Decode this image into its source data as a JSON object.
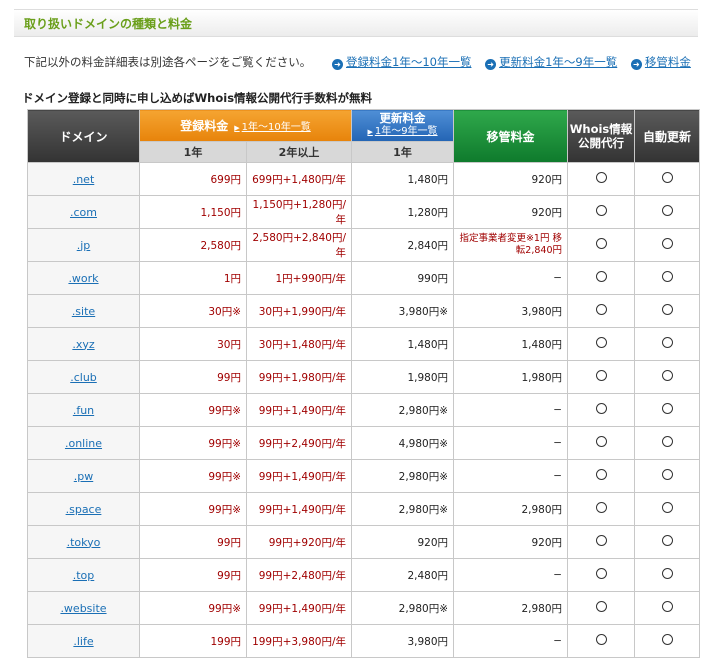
{
  "header": {
    "title": "取り扱いドメインの種類と料金"
  },
  "info": {
    "text": "下記以外の料金詳細表は別途各ページをご覧ください。",
    "links": [
      {
        "label": "登録料金1年〜10年一覧"
      },
      {
        "label": "更新料金1年〜9年一覧"
      },
      {
        "label": "移管料金"
      }
    ]
  },
  "note": "ドメイン登録と同時に申し込めばWhois情報公開代行手数料が無料",
  "table": {
    "headers": {
      "domain": "ドメイン",
      "registration": "登録料金",
      "registration_link": "1年〜10年一覧",
      "renewal": "更新料金",
      "renewal_link": "1年〜9年一覧",
      "transfer": "移管料金",
      "whois": "Whois情報公開代行",
      "auto_renew": "自動更新",
      "year1": "1年",
      "year2plus": "2年以上",
      "renew_year1": "1年"
    },
    "rows": [
      {
        "domain": ".net",
        "reg1": "699円",
        "reg2": "699円+1,480円/年",
        "renew": "1,480円",
        "transfer": "920円",
        "whois": "○",
        "auto": "○"
      },
      {
        "domain": ".com",
        "reg1": "1,150円",
        "reg2": "1,150円+1,280円/年",
        "renew": "1,280円",
        "transfer": "920円",
        "whois": "○",
        "auto": "○"
      },
      {
        "domain": ".jp",
        "reg1": "2,580円",
        "reg2": "2,580円+2,840円/年",
        "renew": "2,840円",
        "transfer": "指定事業者変更※1円 移転2,840円",
        "whois": "○",
        "auto": "○"
      },
      {
        "domain": ".work",
        "reg1": "1円",
        "reg2": "1円+990円/年",
        "renew": "990円",
        "transfer": "−",
        "whois": "○",
        "auto": "○"
      },
      {
        "domain": ".site",
        "reg1": "30円※",
        "reg2": "30円+1,990円/年",
        "renew": "3,980円※",
        "transfer": "3,980円",
        "whois": "○",
        "auto": "○"
      },
      {
        "domain": ".xyz",
        "reg1": "30円",
        "reg2": "30円+1,480円/年",
        "renew": "1,480円",
        "transfer": "1,480円",
        "whois": "○",
        "auto": "○"
      },
      {
        "domain": ".club",
        "reg1": "99円",
        "reg2": "99円+1,980円/年",
        "renew": "1,980円",
        "transfer": "1,980円",
        "whois": "○",
        "auto": "○"
      },
      {
        "domain": ".fun",
        "reg1": "99円※",
        "reg2": "99円+1,490円/年",
        "renew": "2,980円※",
        "transfer": "−",
        "whois": "○",
        "auto": "○"
      },
      {
        "domain": ".online",
        "reg1": "99円※",
        "reg2": "99円+2,490円/年",
        "renew": "4,980円※",
        "transfer": "−",
        "whois": "○",
        "auto": "○"
      },
      {
        "domain": ".pw",
        "reg1": "99円※",
        "reg2": "99円+1,490円/年",
        "renew": "2,980円※",
        "transfer": "−",
        "whois": "○",
        "auto": "○"
      },
      {
        "domain": ".space",
        "reg1": "99円※",
        "reg2": "99円+1,490円/年",
        "renew": "2,980円※",
        "transfer": "2,980円",
        "whois": "○",
        "auto": "○"
      },
      {
        "domain": ".tokyo",
        "reg1": "99円",
        "reg2": "99円+920円/年",
        "renew": "920円",
        "transfer": "920円",
        "whois": "○",
        "auto": "○"
      },
      {
        "domain": ".top",
        "reg1": "99円",
        "reg2": "99円+2,480円/年",
        "renew": "2,480円",
        "transfer": "−",
        "whois": "○",
        "auto": "○"
      },
      {
        "domain": ".website",
        "reg1": "99円※",
        "reg2": "99円+1,490円/年",
        "renew": "2,980円※",
        "transfer": "2,980円",
        "whois": "○",
        "auto": "○"
      },
      {
        "domain": ".life",
        "reg1": "199円",
        "reg2": "199円+3,980円/年",
        "renew": "3,980円",
        "transfer": "−",
        "whois": "○",
        "auto": "○"
      }
    ]
  }
}
